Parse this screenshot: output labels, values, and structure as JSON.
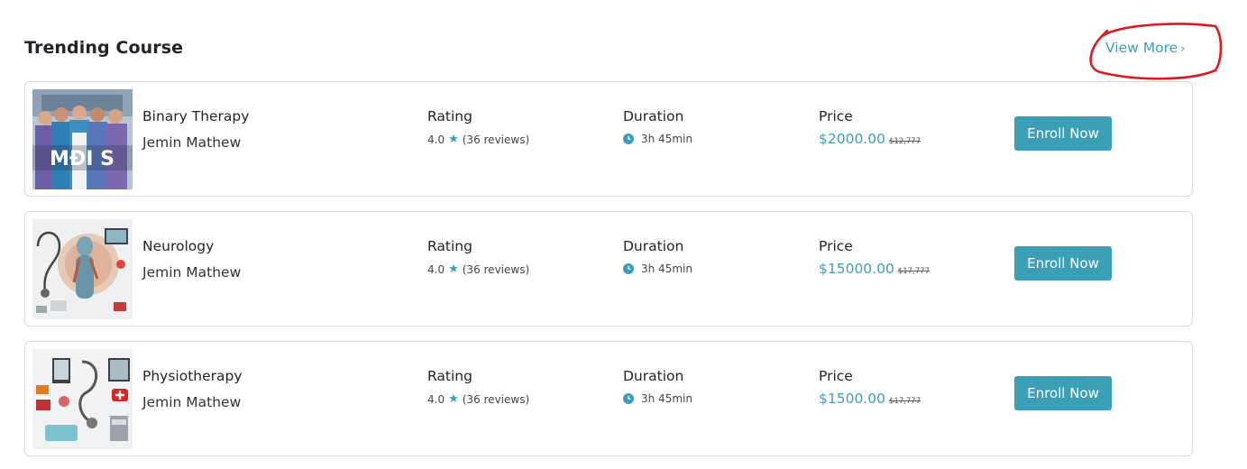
{
  "section": {
    "title": "Trending Course",
    "view_more_label": "View More",
    "view_more_chevron": "›"
  },
  "common": {
    "rating_label": "Rating",
    "duration_label": "Duration",
    "price_label": "Price",
    "enroll_label": "Enroll Now",
    "accent_color": "#3b9fb8",
    "annotation_color": "#e0191c"
  },
  "courses": [
    {
      "name": "Binary Therapy",
      "author": "Jemin Mathew",
      "rating": "4.0",
      "reviews": "(36 reviews)",
      "duration": "3h 45min",
      "price": "$2000.00",
      "old_price": "$12,777",
      "thumb_text": "MĐI S"
    },
    {
      "name": "Neurology",
      "author": "Jemin Mathew",
      "rating": "4.0",
      "reviews": "(36 reviews)",
      "duration": "3h 45min",
      "price": "$15000.00",
      "old_price": "$17,777"
    },
    {
      "name": "Physiotherapy",
      "author": "Jemin Mathew",
      "rating": "4.0",
      "reviews": "(36 reviews)",
      "duration": "3h 45min",
      "price": "$1500.00",
      "old_price": "$17,777"
    }
  ]
}
